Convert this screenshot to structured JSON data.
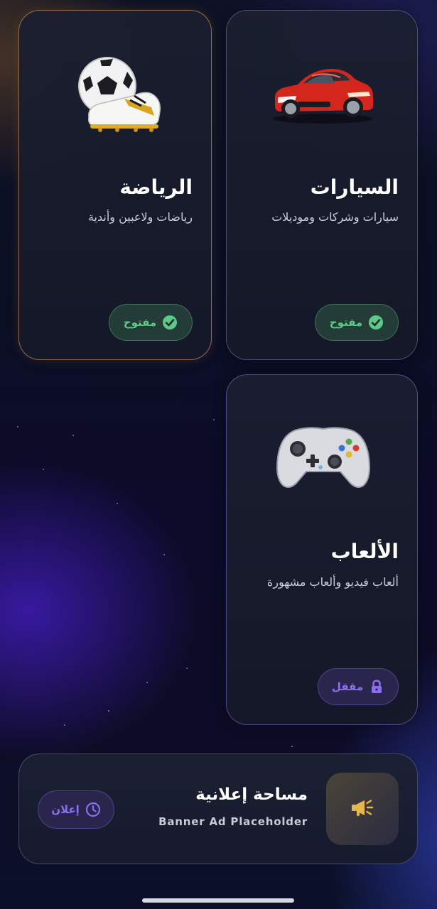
{
  "cards": {
    "cars": {
      "title": "السيارات",
      "description": "سيارات وشركات وموديلات",
      "status": "مفتوح",
      "image": "red-sports-car",
      "status_icon": "check-circle-icon"
    },
    "sports": {
      "title": "الرياضة",
      "description": "رياضات ولاعبين وأندية",
      "status": "مفتوح",
      "image": "soccer-ball-and-cleat",
      "status_icon": "check-circle-icon"
    },
    "games": {
      "title": "الألعاب",
      "description": "ألعاب فيديو وألعاب مشهورة",
      "status": "مقفل",
      "image": "game-controller",
      "status_icon": "lock-icon"
    }
  },
  "ad_banner": {
    "title": "مساحة إعلانية",
    "subtitle": "Banner Ad Placeholder",
    "badge": "إعلان",
    "icon": "megaphone-icon",
    "badge_icon": "clock-icon"
  },
  "colors": {
    "open_green": "#5cc98a",
    "locked_purple": "#8c6ef0",
    "accent_gold": "#e8b84a"
  }
}
